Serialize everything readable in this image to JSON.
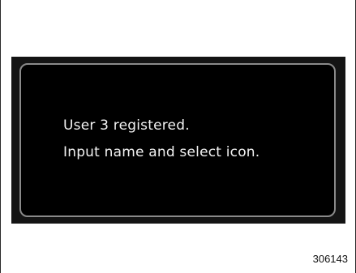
{
  "dialog": {
    "message_line1": "User 3 registered.",
    "message_line2": "Input name and select icon."
  },
  "figure_number": "306143"
}
